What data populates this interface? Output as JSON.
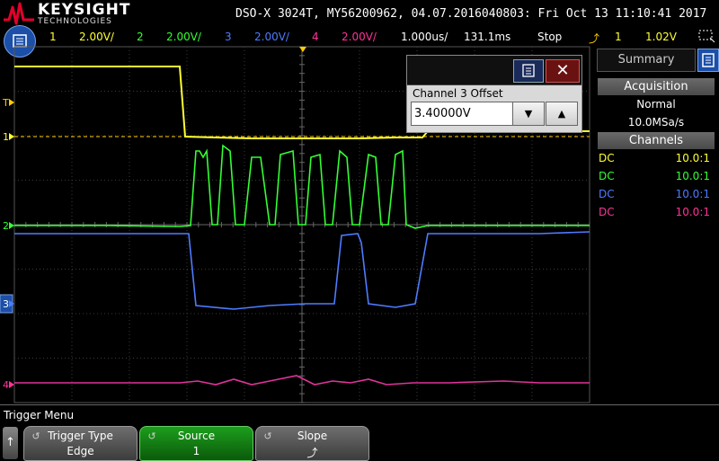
{
  "brand": {
    "name": "KEYSIGHT",
    "sub": "TECHNOLOGIES"
  },
  "header": {
    "instrument": "DSO-X 3024T, MY56200962, 04.07.2016040803: Fri Oct 13 11:10:41 2017"
  },
  "status_bar": {
    "channels": [
      {
        "num": "1",
        "scale": "2.00V/",
        "color": "#ffff33"
      },
      {
        "num": "2",
        "scale": "2.00V/",
        "color": "#33ff33"
      },
      {
        "num": "3",
        "scale": "2.00V/",
        "color": "#4d7cff"
      },
      {
        "num": "4",
        "scale": "2.00V/",
        "color": "#ff3399"
      }
    ],
    "timebase": "1.000us/",
    "delay": "131.1ms",
    "run_state": "Stop",
    "trigger_source": "1",
    "trigger_level": "1.02V"
  },
  "plot": {
    "markers": [
      {
        "label": "T",
        "color": "#ffcc00"
      },
      {
        "label": "1",
        "color": "#ffff33"
      },
      {
        "label": "2",
        "color": "#33ff33"
      },
      {
        "label": "3",
        "color": "#4d7cff"
      },
      {
        "label": "4",
        "color": "#ff3399"
      }
    ],
    "colors": {
      "grid": "#3a3a3a",
      "ch1": "#ffff33",
      "ch2": "#33ff33",
      "ch3": "#4d7cff",
      "ch4": "#e0339a",
      "trigger": "#ffcc00"
    }
  },
  "summary_panel": {
    "tab_label": "Summary",
    "acquisition_header": "Acquisition",
    "acquisition_mode": "Normal",
    "sample_rate": "10.0MSa/s",
    "channels_header": "Channels",
    "channels": [
      {
        "coupling": "DC",
        "probe": "10.0:1",
        "color": "#ffff33"
      },
      {
        "coupling": "DC",
        "probe": "10.0:1",
        "color": "#33ff33"
      },
      {
        "coupling": "DC",
        "probe": "10.0:1",
        "color": "#4d7cff"
      },
      {
        "coupling": "DC",
        "probe": "10.0:1",
        "color": "#ff3399"
      }
    ]
  },
  "dialog": {
    "label": "Channel 3 Offset",
    "value": "3.40000V",
    "close_glyph": "✕",
    "down_glyph": "▼",
    "up_glyph": "▲"
  },
  "softkeys": {
    "menu_title": "Trigger Menu",
    "back_glyph": "↑",
    "keys": [
      {
        "title": "Trigger Type",
        "value": "Edge"
      },
      {
        "title": "Source",
        "value": "1"
      },
      {
        "title": "Slope",
        "value": "⤴"
      }
    ]
  }
}
